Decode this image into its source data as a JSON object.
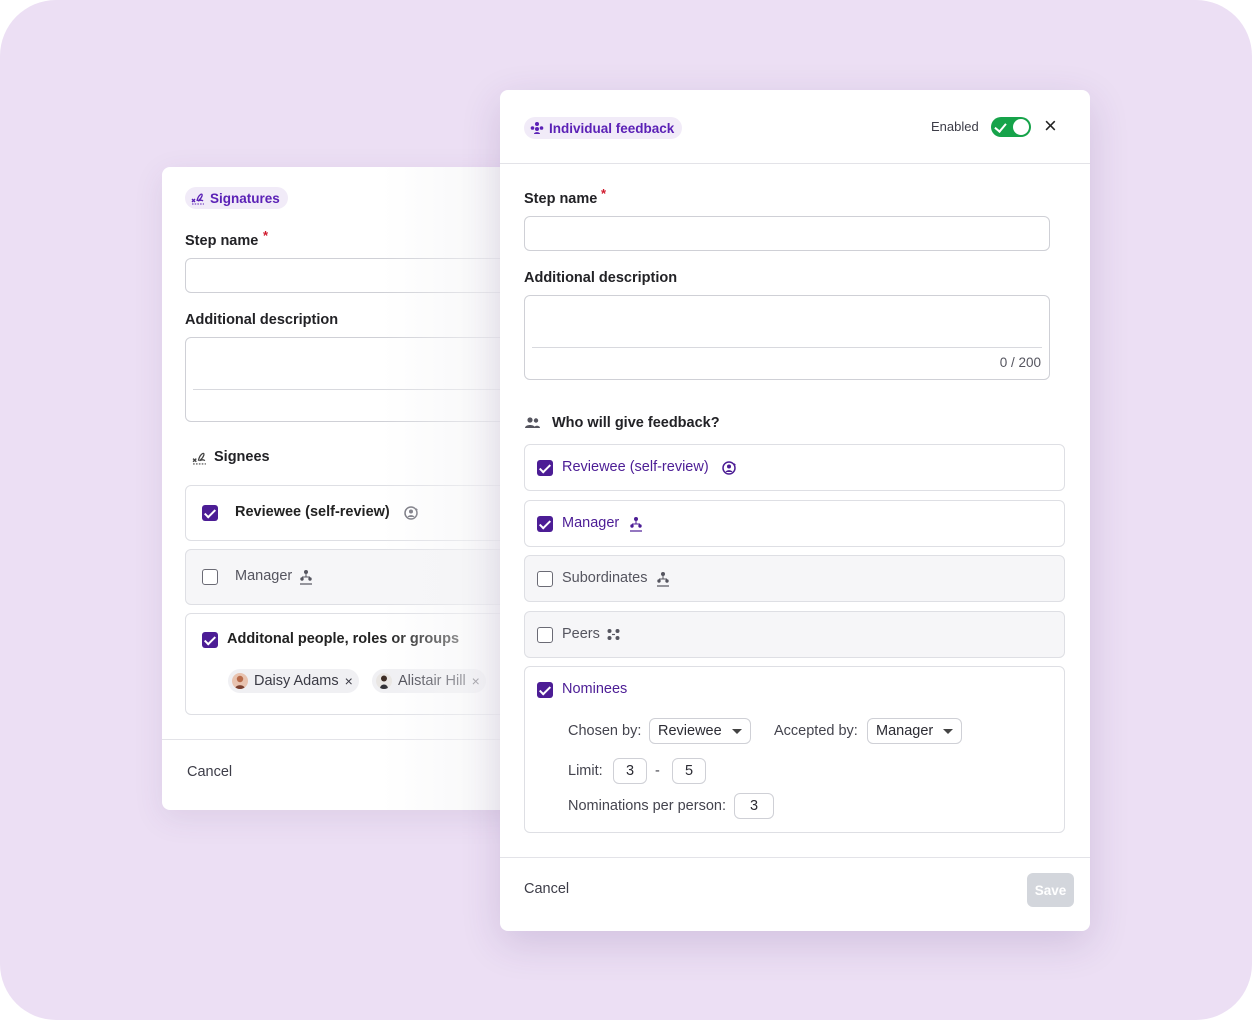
{
  "back_dialog": {
    "tag": "Signatures",
    "step_name_label": "Step name",
    "required_mark": "*",
    "description_label": "Additional description",
    "signees_heading": "Signees",
    "options": [
      {
        "label": "Reviewee (self-review)",
        "checked": true
      },
      {
        "label": "Manager",
        "checked": false
      },
      {
        "label": "Additonal people, roles or groups",
        "checked": true
      }
    ],
    "chips": [
      {
        "name": "Daisy Adams",
        "remove": "×"
      },
      {
        "name": "Alistair Hill",
        "remove": "×"
      }
    ],
    "cancel": "Cancel"
  },
  "front_dialog": {
    "tag": "Individual feedback",
    "enabled_label": "Enabled",
    "enabled": true,
    "close": "×",
    "step_name_label": "Step name",
    "required_mark": "*",
    "description_label": "Additional description",
    "char_count": "0 / 200",
    "who_heading": "Who will give feedback?",
    "options": [
      {
        "label": "Reviewee (self-review)",
        "checked": true
      },
      {
        "label": "Manager",
        "checked": true
      },
      {
        "label": "Subordinates",
        "checked": false
      },
      {
        "label": "Peers",
        "checked": false
      },
      {
        "label": "Nominees",
        "checked": true
      }
    ],
    "nominees": {
      "chosen_by_label": "Chosen by:",
      "chosen_by_value": "Reviewee",
      "accepted_by_label": "Accepted by:",
      "accepted_by_value": "Manager",
      "limit_label": "Limit:",
      "limit_min": "3",
      "limit_sep": "-",
      "limit_max": "5",
      "per_person_label": "Nominations per person:",
      "per_person_value": "3"
    },
    "cancel": "Cancel",
    "save": "Save"
  },
  "colors": {
    "background": "#ecdff4",
    "accent": "#4c1d95",
    "toggle_on": "#16a34a",
    "required": "#d0192c"
  }
}
